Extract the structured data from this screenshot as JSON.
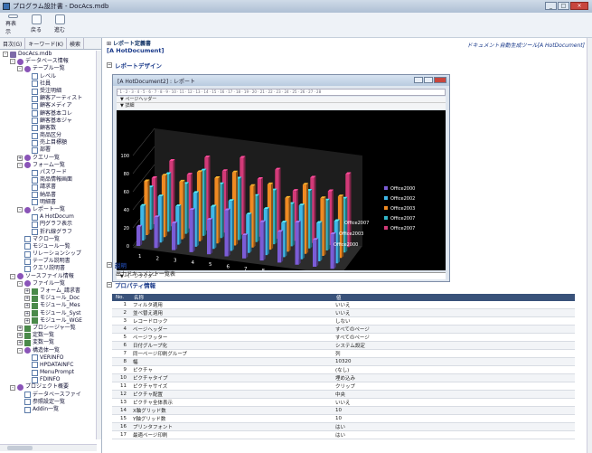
{
  "window": {
    "title": "プログラム設計書 - DocAcs.mdb"
  },
  "toolbar": [
    {
      "label": "再表示",
      "icon": "refresh-icon"
    },
    {
      "label": "戻る",
      "icon": "back-icon"
    },
    {
      "label": "進む",
      "icon": "forward-icon"
    }
  ],
  "sidebar": {
    "tabs": [
      "目次(G)",
      "キーワード(K)",
      "検索"
    ],
    "tree": [
      {
        "label": "DocAcs.mdb",
        "d": 0,
        "e": "-",
        "i": "db"
      },
      {
        "label": "データベース情報",
        "d": 1,
        "e": "-",
        "i": "fl"
      },
      {
        "label": "テーブル一覧",
        "d": 2,
        "e": "-",
        "i": "fl"
      },
      {
        "label": "レベル",
        "d": 3,
        "e": "",
        "i": "tb"
      },
      {
        "label": "社員",
        "d": 3,
        "e": "",
        "i": "tb"
      },
      {
        "label": "受注明細",
        "d": 3,
        "e": "",
        "i": "tb"
      },
      {
        "label": "顧客アーティスト",
        "d": 3,
        "e": "",
        "i": "tb"
      },
      {
        "label": "顧客メディア",
        "d": 3,
        "e": "",
        "i": "tb"
      },
      {
        "label": "顧客基本コレ",
        "d": 3,
        "e": "",
        "i": "tb"
      },
      {
        "label": "顧客基本ジャ",
        "d": 3,
        "e": "",
        "i": "tb"
      },
      {
        "label": "顧客数",
        "d": 3,
        "e": "",
        "i": "tb"
      },
      {
        "label": "商品区分",
        "d": 3,
        "e": "",
        "i": "tb"
      },
      {
        "label": "売上目標額",
        "d": 3,
        "e": "",
        "i": "tb"
      },
      {
        "label": "部署",
        "d": 3,
        "e": "",
        "i": "tb"
      },
      {
        "label": "クエリ一覧",
        "d": 2,
        "e": "+",
        "i": "fl"
      },
      {
        "label": "フォーム一覧",
        "d": 2,
        "e": "-",
        "i": "fl"
      },
      {
        "label": "パスワード",
        "d": 3,
        "e": "",
        "i": "tb"
      },
      {
        "label": "商品情報画面",
        "d": 3,
        "e": "",
        "i": "tb"
      },
      {
        "label": "請求書",
        "d": 3,
        "e": "",
        "i": "tb"
      },
      {
        "label": "納品書",
        "d": 3,
        "e": "",
        "i": "tb"
      },
      {
        "label": "明細書",
        "d": 3,
        "e": "",
        "i": "tb"
      },
      {
        "label": "レポート一覧",
        "d": 2,
        "e": "-",
        "i": "fl"
      },
      {
        "label": "A HotDocum",
        "d": 3,
        "e": "",
        "i": "tb"
      },
      {
        "label": "円グラフ表示",
        "d": 3,
        "e": "",
        "i": "tb"
      },
      {
        "label": "折れ線グラフ",
        "d": 3,
        "e": "",
        "i": "tb"
      },
      {
        "label": "マクロ一覧",
        "d": 2,
        "e": "",
        "i": "tb"
      },
      {
        "label": "モジュール一覧",
        "d": 2,
        "e": "",
        "i": "tb"
      },
      {
        "label": "リレーションシップ",
        "d": 2,
        "e": "",
        "i": "tb"
      },
      {
        "label": "テーブル説明書",
        "d": 2,
        "e": "",
        "i": "tb"
      },
      {
        "label": "クエリ説明書",
        "d": 2,
        "e": "",
        "i": "tb"
      },
      {
        "label": "ソースファイル情報",
        "d": 1,
        "e": "-",
        "i": "fl"
      },
      {
        "label": "ファイル一覧",
        "d": 2,
        "e": "-",
        "i": "fl"
      },
      {
        "label": "フォーム_請求書",
        "d": 3,
        "e": "+",
        "i": "fm"
      },
      {
        "label": "モジュール_Doc",
        "d": 3,
        "e": "+",
        "i": "fm"
      },
      {
        "label": "モジュール_Mes",
        "d": 3,
        "e": "+",
        "i": "fm"
      },
      {
        "label": "モジュール_Syst",
        "d": 3,
        "e": "+",
        "i": "fm"
      },
      {
        "label": "モジュール_WGE",
        "d": 3,
        "e": "+",
        "i": "fm"
      },
      {
        "label": "プロシージャ一覧",
        "d": 2,
        "e": "+",
        "i": "fm"
      },
      {
        "label": "定数一覧",
        "d": 2,
        "e": "+",
        "i": "fm"
      },
      {
        "label": "変数一覧",
        "d": 2,
        "e": "+",
        "i": "fm"
      },
      {
        "label": "構造体一覧",
        "d": 2,
        "e": "-",
        "i": "fl"
      },
      {
        "label": "VERINFO",
        "d": 3,
        "e": "",
        "i": "tb"
      },
      {
        "label": "HPDATAINFC",
        "d": 3,
        "e": "",
        "i": "tb"
      },
      {
        "label": "MenuPrompt",
        "d": 3,
        "e": "",
        "i": "tb"
      },
      {
        "label": "FDINFO",
        "d": 3,
        "e": "",
        "i": "tb"
      },
      {
        "label": "プロジェクト概要",
        "d": 1,
        "e": "-",
        "i": "fl"
      },
      {
        "label": "データベースファイ",
        "d": 2,
        "e": "",
        "i": "tb"
      },
      {
        "label": "参照設定一覧",
        "d": 2,
        "e": "",
        "i": "tb"
      },
      {
        "label": "Addin一覧",
        "d": 2,
        "e": "",
        "i": "tb"
      }
    ]
  },
  "main": {
    "doc_title": "レポート定義書",
    "doc_subtitle": "[A HotDocument]",
    "doc_link": "ドキュメント自動生成ツール[A HotDocument]",
    "sections": {
      "design": "レポートデザイン",
      "desc": "説明",
      "props": "プロパティ情報"
    },
    "description_text": "出力ドキュメント一覧表",
    "report_window_title": "[A HotDocument2] : レポート",
    "bands": {
      "page_header": "ページヘッダー",
      "detail": "詳細",
      "page_footer": "ページフッター"
    },
    "props_headers": [
      "No.",
      "名称",
      "値"
    ],
    "props_rows": [
      [
        "1",
        "フィルタ適用",
        "いいえ"
      ],
      [
        "2",
        "並べ替え適用",
        "いいえ"
      ],
      [
        "3",
        "レコードロック",
        "しない"
      ],
      [
        "4",
        "ページヘッダー",
        "すべてのページ"
      ],
      [
        "5",
        "ページフッター",
        "すべてのページ"
      ],
      [
        "6",
        "日付グループ化",
        "システム設定"
      ],
      [
        "7",
        "同一ページ印刷グループ",
        "列"
      ],
      [
        "8",
        "幅",
        "10320"
      ],
      [
        "9",
        "ピクチャ",
        "(なし)"
      ],
      [
        "10",
        "ピクチャタイプ",
        "埋め込み"
      ],
      [
        "11",
        "ピクチャサイズ",
        "クリップ"
      ],
      [
        "12",
        "ピクチャ配置",
        "中央"
      ],
      [
        "13",
        "ピクチャ全体表示",
        "いいえ"
      ],
      [
        "14",
        "X軸グリッド数",
        "10"
      ],
      [
        "15",
        "Y軸グリッド数",
        "10"
      ],
      [
        "16",
        "プリンタフォント",
        "はい"
      ],
      [
        "17",
        "最適ページ印刷",
        "はい"
      ]
    ]
  },
  "chart_data": {
    "type": "bar",
    "title": "",
    "categories": [
      "1",
      "2",
      "3",
      "4",
      "5",
      "6",
      "7",
      "8",
      "9",
      "10",
      "11",
      "12"
    ],
    "yticks": [
      "0",
      "20",
      "40",
      "60",
      "80",
      "100"
    ],
    "ylim": [
      0,
      100
    ],
    "series": [
      {
        "name": "Office2000",
        "color": "#7b5cd6",
        "values": [
          25,
          40,
          35,
          55,
          45,
          60,
          30,
          50,
          40,
          55,
          35,
          45
        ]
      },
      {
        "name": "Office2002",
        "color": "#3fb8e8",
        "values": [
          45,
          60,
          50,
          70,
          55,
          65,
          50,
          60,
          45,
          70,
          50,
          55
        ]
      },
      {
        "name": "Office2003",
        "color": "#f08a22",
        "values": [
          70,
          80,
          75,
          90,
          85,
          95,
          80,
          85,
          70,
          90,
          75,
          80
        ]
      },
      {
        "name": "Office2007",
        "color": "#33b6c8",
        "values": [
          55,
          75,
          65,
          85,
          70,
          80,
          60,
          70,
          55,
          75,
          65,
          70
        ]
      },
      {
        "name": "Office2007",
        "color": "#d23a78",
        "values": [
          60,
          85,
          70,
          95,
          80,
          100,
          75,
          90,
          65,
          85,
          70,
          95
        ]
      }
    ],
    "floor_labels": [
      "Office2007",
      "Office2003",
      "Office2000"
    ],
    "legend_position": "right"
  },
  "colors": {
    "header_bg": "#39527a",
    "link": "#1a3a8a"
  }
}
